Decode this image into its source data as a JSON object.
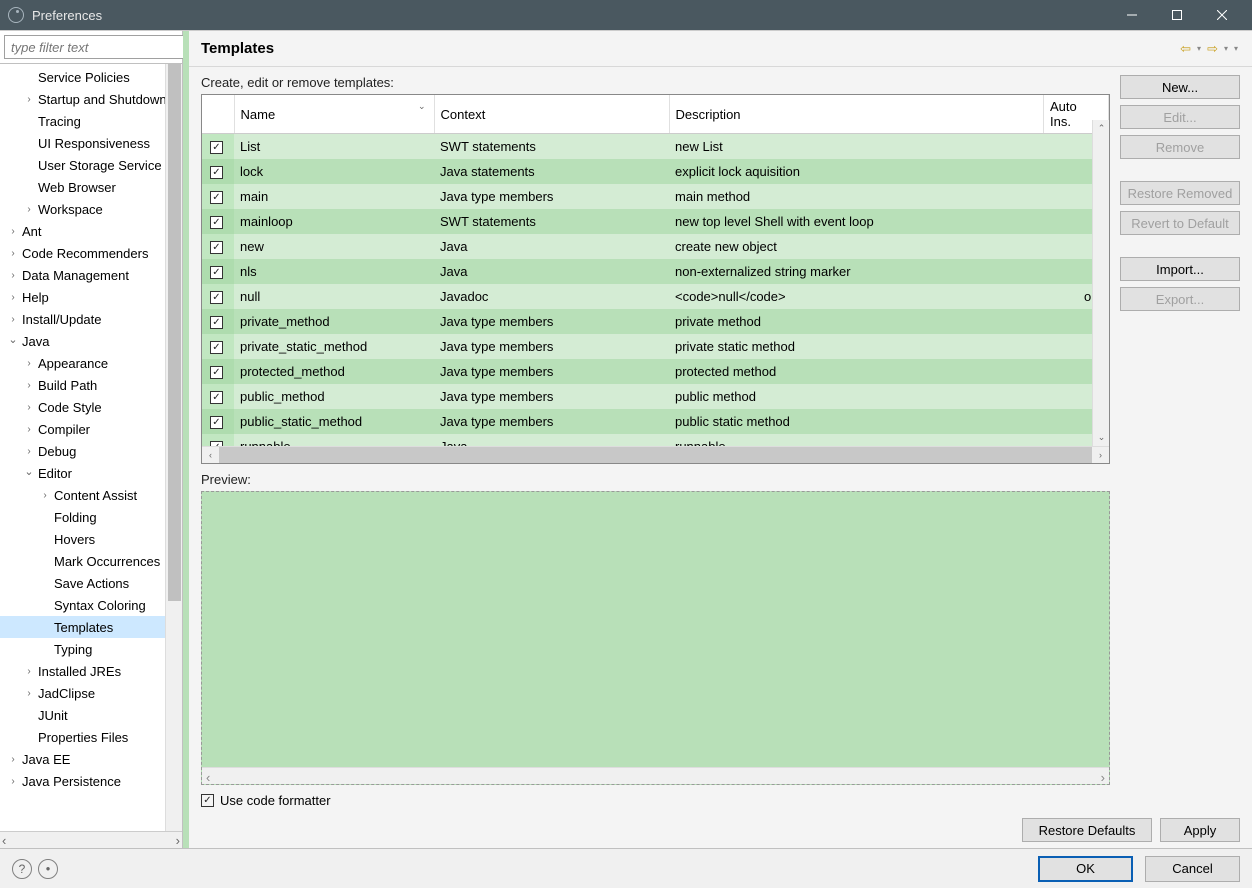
{
  "window": {
    "title": "Preferences"
  },
  "filter": {
    "placeholder": "type filter text"
  },
  "tree": [
    {
      "lbl": "Service Policies",
      "indent": 1,
      "exp": "none"
    },
    {
      "lbl": "Startup and Shutdown",
      "indent": 1,
      "exp": "collapsed"
    },
    {
      "lbl": "Tracing",
      "indent": 1,
      "exp": "none"
    },
    {
      "lbl": "UI Responsiveness",
      "indent": 1,
      "exp": "none"
    },
    {
      "lbl": "User Storage Service",
      "indent": 1,
      "exp": "none"
    },
    {
      "lbl": "Web Browser",
      "indent": 1,
      "exp": "none"
    },
    {
      "lbl": "Workspace",
      "indent": 1,
      "exp": "collapsed"
    },
    {
      "lbl": "Ant",
      "indent": 0,
      "exp": "collapsed"
    },
    {
      "lbl": "Code Recommenders",
      "indent": 0,
      "exp": "collapsed"
    },
    {
      "lbl": "Data Management",
      "indent": 0,
      "exp": "collapsed"
    },
    {
      "lbl": "Help",
      "indent": 0,
      "exp": "collapsed"
    },
    {
      "lbl": "Install/Update",
      "indent": 0,
      "exp": "collapsed"
    },
    {
      "lbl": "Java",
      "indent": 0,
      "exp": "expanded"
    },
    {
      "lbl": "Appearance",
      "indent": 1,
      "exp": "collapsed"
    },
    {
      "lbl": "Build Path",
      "indent": 1,
      "exp": "collapsed"
    },
    {
      "lbl": "Code Style",
      "indent": 1,
      "exp": "collapsed"
    },
    {
      "lbl": "Compiler",
      "indent": 1,
      "exp": "collapsed"
    },
    {
      "lbl": "Debug",
      "indent": 1,
      "exp": "collapsed"
    },
    {
      "lbl": "Editor",
      "indent": 1,
      "exp": "expanded"
    },
    {
      "lbl": "Content Assist",
      "indent": 2,
      "exp": "collapsed"
    },
    {
      "lbl": "Folding",
      "indent": 2,
      "exp": "none"
    },
    {
      "lbl": "Hovers",
      "indent": 2,
      "exp": "none"
    },
    {
      "lbl": "Mark Occurrences",
      "indent": 2,
      "exp": "none"
    },
    {
      "lbl": "Save Actions",
      "indent": 2,
      "exp": "none"
    },
    {
      "lbl": "Syntax Coloring",
      "indent": 2,
      "exp": "none"
    },
    {
      "lbl": "Templates",
      "indent": 2,
      "exp": "none",
      "selected": true
    },
    {
      "lbl": "Typing",
      "indent": 2,
      "exp": "none"
    },
    {
      "lbl": "Installed JREs",
      "indent": 1,
      "exp": "collapsed"
    },
    {
      "lbl": "JadClipse",
      "indent": 1,
      "exp": "collapsed"
    },
    {
      "lbl": "JUnit",
      "indent": 1,
      "exp": "none"
    },
    {
      "lbl": "Properties Files",
      "indent": 1,
      "exp": "none"
    },
    {
      "lbl": "Java EE",
      "indent": 0,
      "exp": "collapsed"
    },
    {
      "lbl": "Java Persistence",
      "indent": 0,
      "exp": "collapsed"
    }
  ],
  "page": {
    "title": "Templates",
    "caption": "Create, edit or remove templates:",
    "preview_label": "Preview:",
    "use_formatter": "Use code formatter"
  },
  "columns": {
    "name": "Name",
    "context": "Context",
    "description": "Description",
    "auto": "Auto Ins."
  },
  "rows": [
    {
      "name": "List",
      "context": "SWT statements",
      "desc": "new List",
      "auto": ""
    },
    {
      "name": "lock",
      "context": "Java statements",
      "desc": "explicit lock aquisition",
      "auto": ""
    },
    {
      "name": "main",
      "context": "Java type members",
      "desc": "main method",
      "auto": ""
    },
    {
      "name": "mainloop",
      "context": "SWT statements",
      "desc": "new top level Shell with event loop",
      "auto": ""
    },
    {
      "name": "new",
      "context": "Java",
      "desc": "create new object",
      "auto": ""
    },
    {
      "name": "nls",
      "context": "Java",
      "desc": "non-externalized string marker",
      "auto": ""
    },
    {
      "name": "null",
      "context": "Javadoc",
      "desc": "<code>null</code>",
      "auto": "on"
    },
    {
      "name": "private_method",
      "context": "Java type members",
      "desc": "private method",
      "auto": ""
    },
    {
      "name": "private_static_method",
      "context": "Java type members",
      "desc": "private static method",
      "auto": ""
    },
    {
      "name": "protected_method",
      "context": "Java type members",
      "desc": "protected method",
      "auto": ""
    },
    {
      "name": "public_method",
      "context": "Java type members",
      "desc": "public method",
      "auto": ""
    },
    {
      "name": "public_static_method",
      "context": "Java type members",
      "desc": "public static method",
      "auto": ""
    },
    {
      "name": "runnable",
      "context": "Java",
      "desc": "runnable",
      "auto": ""
    }
  ],
  "buttons": {
    "new": "New...",
    "edit": "Edit...",
    "remove": "Remove",
    "restore_removed": "Restore Removed",
    "revert_default": "Revert to Default",
    "import": "Import...",
    "export": "Export...",
    "restore_defaults": "Restore Defaults",
    "apply": "Apply",
    "ok": "OK",
    "cancel": "Cancel"
  }
}
